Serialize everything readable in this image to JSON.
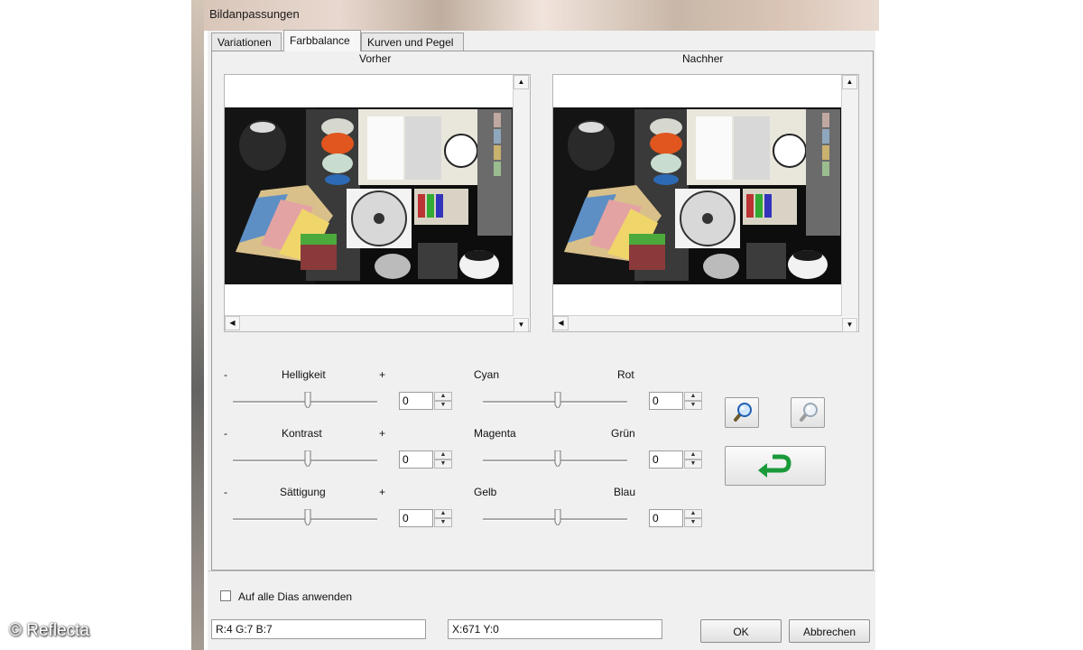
{
  "window": {
    "title": "Bildanpassungen"
  },
  "tabs": [
    {
      "label": "Variationen"
    },
    {
      "label": "Farbbalance"
    },
    {
      "label": "Kurven und Pegel"
    }
  ],
  "preview": {
    "before_label": "Vorher",
    "after_label": "Nachher"
  },
  "left_sliders": {
    "minus": "-",
    "plus": "+",
    "items": [
      {
        "label": "Helligkeit",
        "value": "0"
      },
      {
        "label": "Kontrast",
        "value": "0"
      },
      {
        "label": "Sättigung",
        "value": "0"
      }
    ]
  },
  "color_sliders": [
    {
      "left_label": "Cyan",
      "right_label": "Rot",
      "value": "0"
    },
    {
      "left_label": "Magenta",
      "right_label": "Grün",
      "value": "0"
    },
    {
      "left_label": "Gelb",
      "right_label": "Blau",
      "value": "0"
    }
  ],
  "tools": {
    "zoom_in": "zoom-in-icon",
    "zoom_out": "zoom-out-icon",
    "reset": "undo-arrow-icon"
  },
  "apply_all": {
    "label": "Auf alle Dias anwenden",
    "checked": false
  },
  "status": {
    "rgb": "R:4 G:7 B:7",
    "coords": "X:671 Y:0"
  },
  "buttons": {
    "ok": "OK",
    "cancel": "Abbrechen"
  },
  "watermark": "© Reflecta",
  "colors": {
    "panel": "#f0f0f0",
    "arrow_green": "#1a9a3a"
  }
}
